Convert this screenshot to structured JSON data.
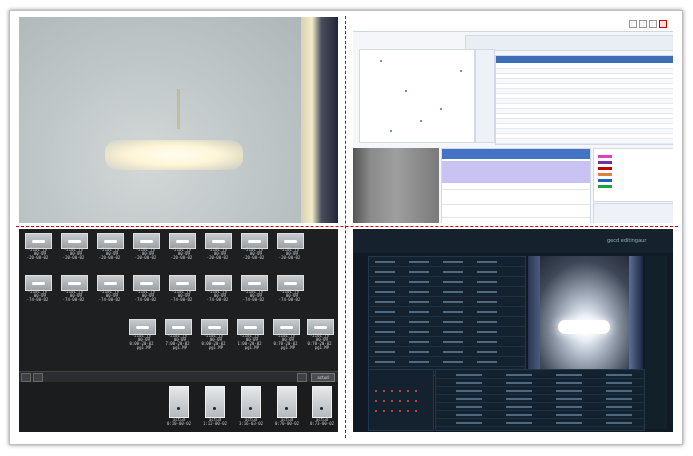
{
  "grid_thumbnails": {
    "row1": [
      {
        "caption": "-2101_jy\n  00-09\n-20-00-02"
      },
      {
        "caption": "-2101_jy\n  00-09\n-20-00-02"
      },
      {
        "caption": "-2101_jy\n  00-09\n-20-00-02"
      },
      {
        "caption": "-2101_jy\n  00-09\n-20-00-02"
      },
      {
        "caption": "-2101_jy\n  00-09\n-20-00-02"
      },
      {
        "caption": "-2101_jy\n  00-09\n-20-00-02"
      },
      {
        "caption": "-2101_jy\n  00-09\n-20-00-02"
      },
      {
        "caption": "-2101_jy\n  00-09\n-20-00-02"
      }
    ],
    "row2": [
      {
        "caption": "-2101_jy\n  00-09\n-74-00-02"
      },
      {
        "caption": "-2101_jy\n  00-09\n-74-00-02"
      },
      {
        "caption": "-2101_jy\n  00-09\n-74-00-02"
      },
      {
        "caption": "-2101_jy\n  00-09\n-74-00-02"
      },
      {
        "caption": "-2101_jy\n  00-09\n-74-00-02"
      },
      {
        "caption": "-2101_jy\n  00-09\n-74-00-02"
      },
      {
        "caption": "-2101_jy\n  00-09\n-74-00-02"
      },
      {
        "caption": "-2101_jy\n  00-09\n-74-00-02"
      }
    ],
    "row3": [
      {
        "caption": "-2101_jy\n  00-09\n0:00-20-02\n  pg1.MP"
      },
      {
        "caption": "-2101_jy\n  00-09\n7:00-20-02\n  pg1.MP"
      },
      {
        "caption": "-2101_jy\n  00-09\n0:00-20-02\n  pg1.MP"
      },
      {
        "caption": "-2101_jy\n  00-09\n1:00-20-02\n  pg1.MP"
      },
      {
        "caption": "-2101_jy\n  00-09\n0:70-20-02\n  pg1.MP"
      },
      {
        "caption": "-2101_jy\n  00-09\n0:70-20-02\n  pg1.MP"
      }
    ]
  },
  "toolbar": {
    "action_label": "actud"
  },
  "bottom_tiles": [
    {
      "caption": "actud\n0:10-00-02"
    },
    {
      "caption": "actud\n1:12-00-02"
    },
    {
      "caption": "actud\n3:16-03-02"
    },
    {
      "caption": "actud\n0:70-00-02"
    },
    {
      "caption": "actud\n0:73-00-02"
    }
  ],
  "dashboard": {
    "header_label": "gecd editingaur"
  }
}
